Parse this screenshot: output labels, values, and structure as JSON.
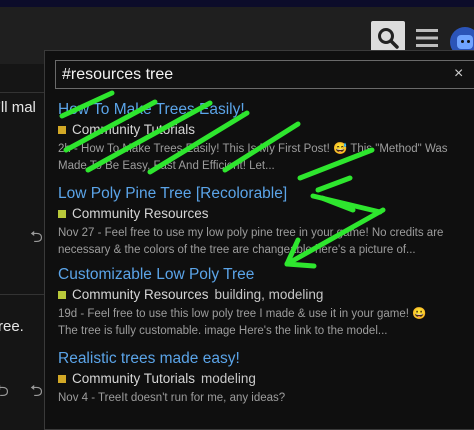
{
  "page": {
    "left_snippet_1": "'ll mal",
    "left_snippet_2": "ree."
  },
  "header": {
    "search_icon": "search-icon",
    "menu_icon": "hamburger-icon",
    "avatar_icon": "avatar-icon"
  },
  "search": {
    "query": "#resources tree",
    "clear_label": "×"
  },
  "results": [
    {
      "title": "How To Make Trees Easily!",
      "category": "Community Tutorials",
      "category_color": "#d2a826",
      "tags": "",
      "line1": "2h - How To Make Trees Easily! This Is My First Post! 😅 This \"Method\" Was",
      "line2": "Made To Be Easy, Fast And Efficient! Let..."
    },
    {
      "title": "Low Poly Pine Tree [Recolorable]",
      "category": "Community Resources",
      "category_color": "#b8c83a",
      "tags": "",
      "line1": "Nov 27 - Feel free to use my low poly pine tree in your game! No credits are",
      "line2": "necessary & the colors of the tree are changeable here's a picture of..."
    },
    {
      "title": "Customizable Low Poly Tree",
      "category": "Community Resources",
      "category_color": "#b8c83a",
      "tags": "building, modeling",
      "line1": "19d - Feel free to use this low poly tree I made & use it in your game! 😀",
      "line2": "The tree is fully customable. image Here's the link to the model..."
    },
    {
      "title": "Realistic trees made easy!",
      "category": "Community Tutorials",
      "category_color": "#d2a826",
      "tags": "modeling",
      "line1": "Nov 4 - TreeIt doesn't run for me, any ideas?",
      "line2": ""
    }
  ],
  "colors": {
    "link": "#5ba4e8",
    "scribble": "#2ee62e",
    "resources_swatch": "#b8c83a",
    "tutorials_swatch": "#d2a826"
  }
}
